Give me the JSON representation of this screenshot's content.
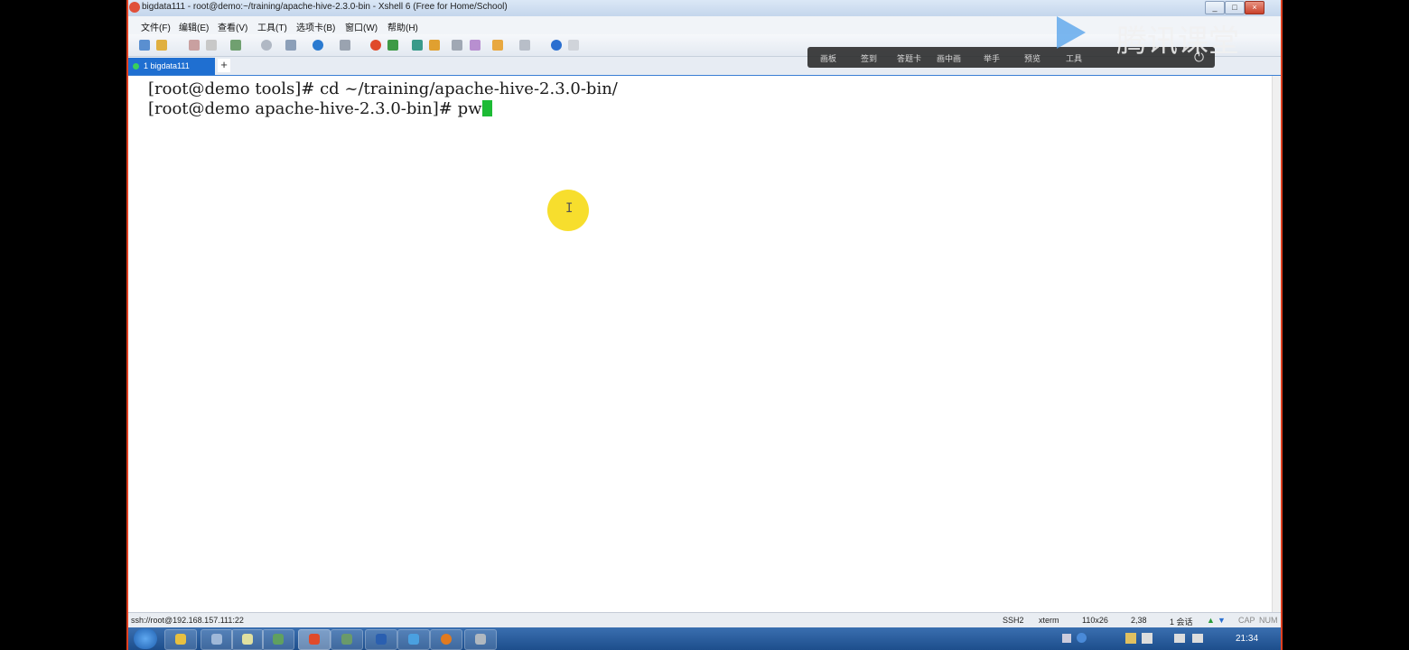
{
  "window": {
    "title": "bigdata111 - root@demo:~/training/apache-hive-2.3.0-bin - Xshell 6 (Free for Home/School)",
    "min": "_",
    "max": "□",
    "close": "×"
  },
  "menu": {
    "items": [
      "文件(F)",
      "编辑(E)",
      "查看(V)",
      "工具(T)",
      "选项卡(B)",
      "窗口(W)",
      "帮助(H)"
    ]
  },
  "tabs": {
    "session_label": "1 bigdata111",
    "new_tab": "+"
  },
  "terminal": {
    "lines": [
      "[root@demo tools]# cd ~/training/apache-hive-2.3.0-bin/",
      "[root@demo apache-hive-2.3.0-bin]# pw"
    ],
    "cursor_color": "#1dbb35"
  },
  "overlay": {
    "items": [
      "画板",
      "签到",
      "答题卡",
      "画中画",
      "举手",
      "预览",
      "工具"
    ]
  },
  "watermark": {
    "text": "腾讯课堂"
  },
  "status": {
    "connection": "ssh://root@192.168.157.111:22",
    "protocol": "SSH2",
    "term": "xterm",
    "size": "110x26",
    "position": "2,38",
    "sessions": "1 会话",
    "caps": "CAP",
    "num": "NUM"
  },
  "taskbar": {
    "time": "21:34"
  },
  "colors": {
    "accent": "#1f6fd1",
    "highlight": "#f7dc1c",
    "border_red": "#e04020"
  }
}
